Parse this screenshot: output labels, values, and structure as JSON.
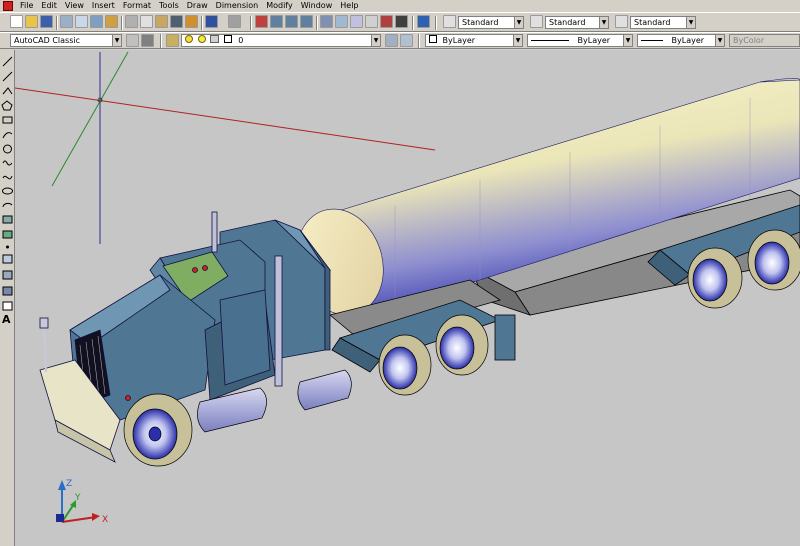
{
  "menu": {
    "items": [
      "File",
      "Edit",
      "View",
      "Insert",
      "Format",
      "Tools",
      "Draw",
      "Dimension",
      "Modify",
      "Window",
      "Help"
    ]
  },
  "styles_toolbar": {
    "text_style": "Standard",
    "dim_style": "Standard",
    "table_style": "Standard"
  },
  "workspace": {
    "value": "AutoCAD Classic"
  },
  "layers": {
    "current_layer": "0"
  },
  "properties": {
    "color": "ByLayer",
    "linetype": "ByLayer",
    "lineweight": "ByLayer",
    "plotstyle": "ByColor"
  },
  "ucs": {
    "x_label": "X",
    "y_label": "Y",
    "z_label": "Z"
  },
  "left_toolbar": {
    "text_tool_label": "A"
  },
  "colors": {
    "ui_face": "#d4d0c8",
    "viewport_bg": "#c6c6c6",
    "cab_blue": "#4f7793",
    "tank_cream": "#f3eec0",
    "tank_blue": "#2a2ea8"
  }
}
